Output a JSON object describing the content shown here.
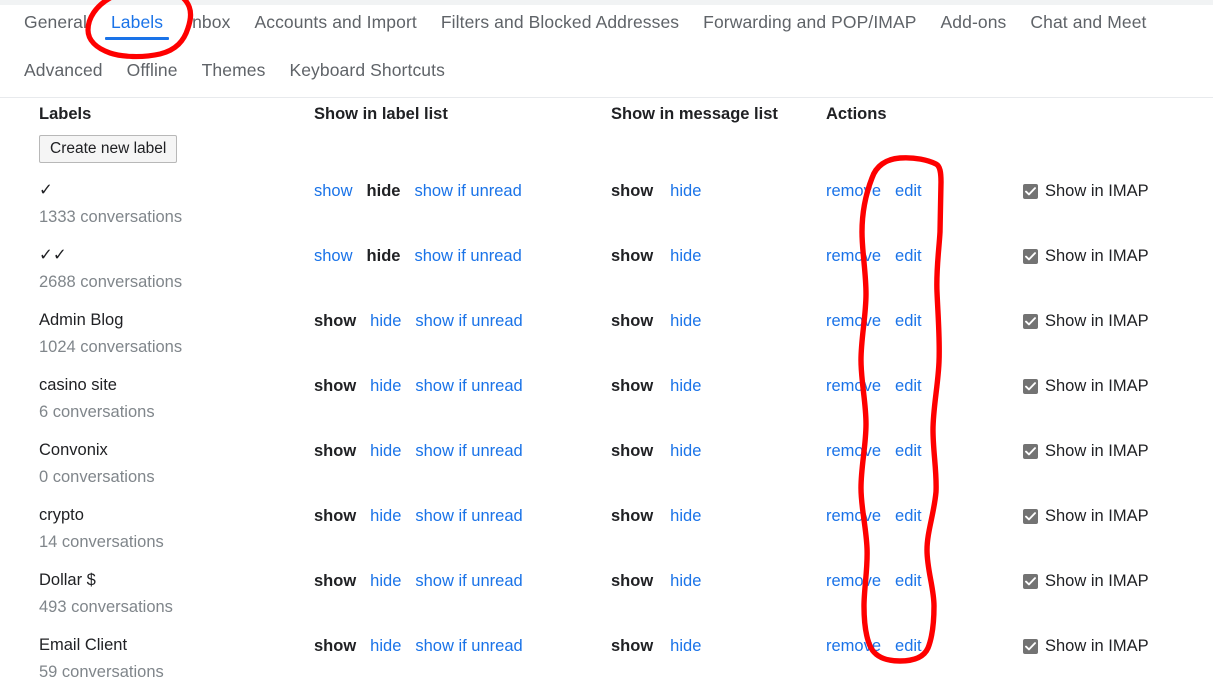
{
  "tabs_row1": [
    {
      "label": "General",
      "active": false
    },
    {
      "label": "Labels",
      "active": true
    },
    {
      "label": "Inbox",
      "active": false
    },
    {
      "label": "Accounts and Import",
      "active": false
    },
    {
      "label": "Filters and Blocked Addresses",
      "active": false
    },
    {
      "label": "Forwarding and POP/IMAP",
      "active": false
    },
    {
      "label": "Add-ons",
      "active": false
    },
    {
      "label": "Chat and Meet",
      "active": false
    }
  ],
  "tabs_row2": [
    {
      "label": "Advanced",
      "active": false
    },
    {
      "label": "Offline",
      "active": false
    },
    {
      "label": "Themes",
      "active": false
    },
    {
      "label": "Keyboard Shortcuts",
      "active": false
    }
  ],
  "headers": {
    "labels": "Labels",
    "show_in_label_list": "Show in label list",
    "show_in_message_list": "Show in message list",
    "actions": "Actions"
  },
  "create_button": "Create new label",
  "link_text": {
    "show": "show",
    "hide": "hide",
    "show_if_unread": "show if unread",
    "remove": "remove",
    "edit": "edit",
    "show_in_imap": "Show in IMAP"
  },
  "colors": {
    "link": "#1a73e8",
    "accent": "#1a73e8",
    "text": "#202124",
    "muted": "#80868b",
    "tab": "#5f6368",
    "annotation": "#fe0000",
    "checkbox": "#737373"
  },
  "rows": [
    {
      "name": "✓",
      "count": "1333 conversations",
      "label_list": "hide",
      "message_list": "show",
      "imap_checked": true
    },
    {
      "name": "✓✓",
      "count": "2688 conversations",
      "label_list": "hide",
      "message_list": "show",
      "imap_checked": true
    },
    {
      "name": "Admin Blog",
      "count": "1024 conversations",
      "label_list": "show",
      "message_list": "show",
      "imap_checked": true
    },
    {
      "name": "casino site",
      "count": "6 conversations",
      "label_list": "show",
      "message_list": "show",
      "imap_checked": true
    },
    {
      "name": "Convonix",
      "count": "0 conversations",
      "label_list": "show",
      "message_list": "show",
      "imap_checked": true
    },
    {
      "name": "crypto",
      "count": "14 conversations",
      "label_list": "show",
      "message_list": "show",
      "imap_checked": true
    },
    {
      "name": "Dollar $",
      "count": "493 conversations",
      "label_list": "show",
      "message_list": "show",
      "imap_checked": true
    },
    {
      "name": "Email Client",
      "count": "59 conversations",
      "label_list": "show",
      "message_list": "show",
      "imap_checked": true
    }
  ],
  "annotations": [
    {
      "name": "labels-tab-circle",
      "shape": "ellipse",
      "note": "red hand-drawn circle around Labels tab"
    },
    {
      "name": "remove-column-circle",
      "shape": "ellipse",
      "note": "red hand-drawn vertical oval around remove links"
    }
  ]
}
